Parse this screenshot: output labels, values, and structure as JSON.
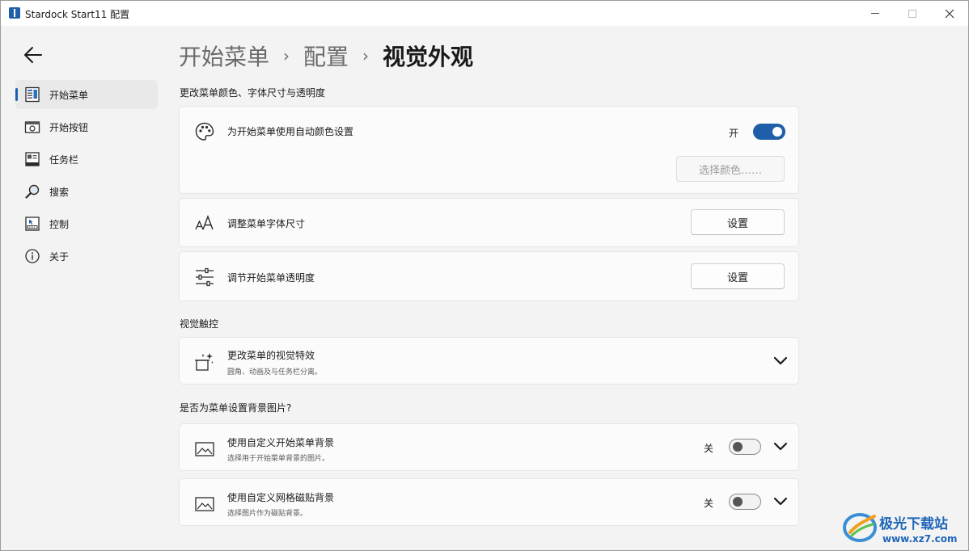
{
  "window": {
    "title": "Stardock Start11 配置"
  },
  "sidebar": {
    "items": [
      {
        "label": "开始菜单",
        "icon": "start-menu-icon",
        "active": true
      },
      {
        "label": "开始按钮",
        "icon": "start-button-icon",
        "active": false
      },
      {
        "label": "任务栏",
        "icon": "taskbar-icon",
        "active": false
      },
      {
        "label": "搜索",
        "icon": "search-icon",
        "active": false
      },
      {
        "label": "控制",
        "icon": "control-icon",
        "active": false
      },
      {
        "label": "关于",
        "icon": "info-icon",
        "active": false
      }
    ]
  },
  "breadcrumb": {
    "items": [
      "开始菜单",
      "配置",
      "视觉外观"
    ],
    "separator": "›"
  },
  "sections": {
    "appearance": {
      "label": "更改菜单颜色、字体尺寸与透明度",
      "auto_color": {
        "title": "为开始菜单使用自动颜色设置",
        "state_label": "开",
        "enabled": true,
        "choose_color_label": "选择颜色……"
      },
      "font_size": {
        "title": "调整菜单字体尺寸",
        "button_label": "设置"
      },
      "transparency": {
        "title": "调节开始菜单透明度",
        "button_label": "设置"
      }
    },
    "visual_touch": {
      "label": "视觉触控",
      "effects": {
        "title": "更改菜单的视觉特效",
        "subtitle": "圆角、动画及与任务栏分离。"
      }
    },
    "background": {
      "label": "是否为菜单设置背景图片?",
      "custom_start_bg": {
        "title": "使用自定义开始菜单背景",
        "subtitle": "选择用于开始菜单背景的图片。",
        "state_label": "关",
        "enabled": false
      },
      "custom_tile_bg": {
        "title": "使用自定义网格磁贴背景",
        "subtitle": "选择图片作为磁贴背景。",
        "state_label": "关",
        "enabled": false
      }
    }
  },
  "watermark": {
    "text": "极光下载站",
    "url": "www.xz7.com"
  },
  "colors": {
    "accent": "#1f5ea8",
    "background": "#f3f3f3",
    "card": "#fbfbfb"
  }
}
